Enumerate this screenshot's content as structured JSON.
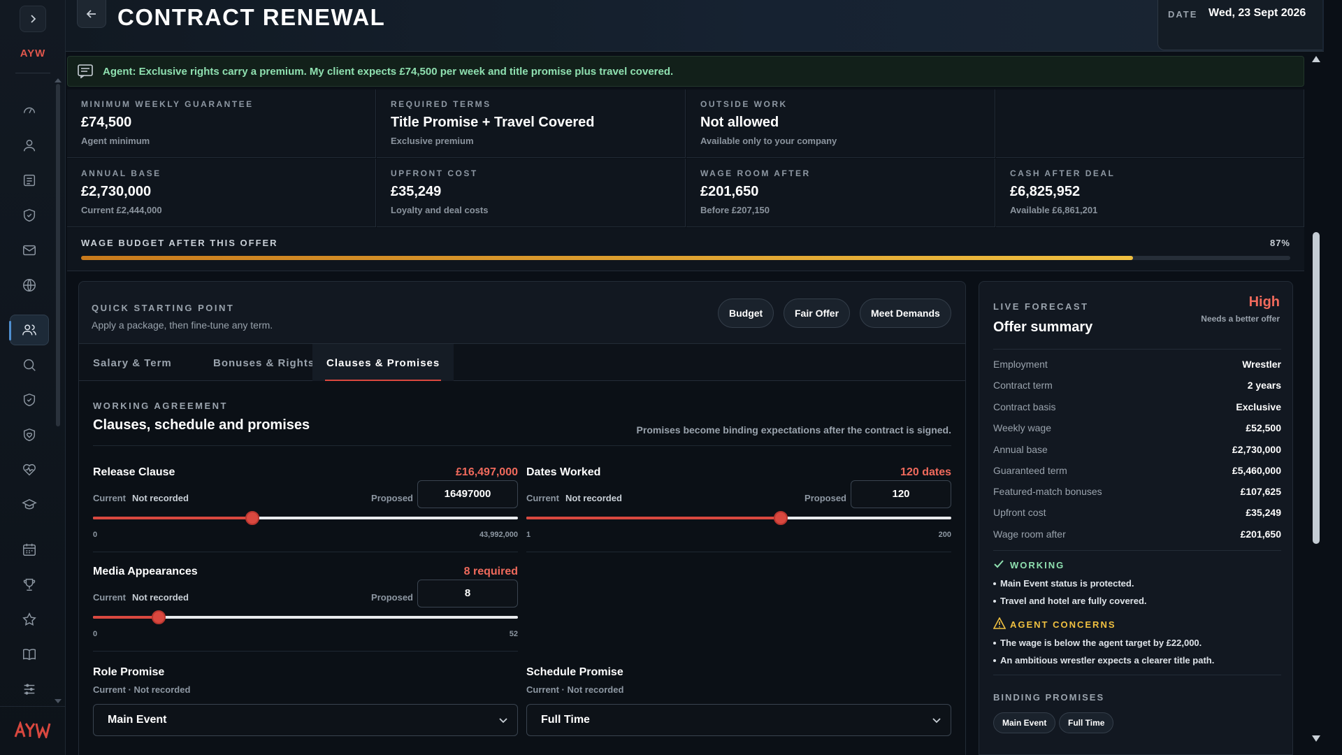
{
  "header": {
    "title": "CONTRACT RENEWAL",
    "date_label": "DATE",
    "date_value": "Wed, 23 Sept 2026"
  },
  "sidebar": {
    "brand": "AYW",
    "items": [
      {
        "icon": "speedometer-icon"
      },
      {
        "icon": "user-icon"
      },
      {
        "icon": "document-icon"
      },
      {
        "icon": "shield-icon"
      },
      {
        "icon": "mail-icon"
      },
      {
        "icon": "globe-icon"
      },
      {
        "icon": "users-icon",
        "active": true
      },
      {
        "icon": "search-icon"
      },
      {
        "icon": "shield-check-icon"
      },
      {
        "icon": "heart-shield-icon"
      },
      {
        "icon": "heart-pulse-icon"
      },
      {
        "icon": "graduation-cap-icon"
      },
      {
        "icon": "calendar-icon"
      },
      {
        "icon": "trophy-icon"
      },
      {
        "icon": "star-icon"
      },
      {
        "icon": "book-icon"
      },
      {
        "icon": "sliders-icon"
      }
    ],
    "logo": "AYW"
  },
  "agent_message": "Agent: Exclusive rights carry a premium. My client expects £74,500 per week and title promise plus travel covered.",
  "stats": {
    "min_weekly": {
      "label": "MINIMUM WEEKLY GUARANTEE",
      "value": "£74,500",
      "sub": "Agent minimum"
    },
    "required_terms": {
      "label": "REQUIRED TERMS",
      "value": "Title Promise + Travel Covered",
      "sub": "Exclusive premium"
    },
    "outside_work": {
      "label": "OUTSIDE WORK",
      "value": "Not allowed",
      "sub": "Available only to your company"
    },
    "annual_base": {
      "label": "ANNUAL BASE",
      "value": "£2,730,000",
      "sub": "Current £2,444,000"
    },
    "upfront_cost": {
      "label": "UPFRONT COST",
      "value": "£35,249",
      "sub": "Loyalty and deal costs"
    },
    "wage_room": {
      "label": "WAGE ROOM AFTER",
      "value": "£201,650",
      "sub": "Before £207,150"
    },
    "cash_after": {
      "label": "CASH AFTER DEAL",
      "value": "£6,825,952",
      "sub": "Available £6,861,201"
    }
  },
  "wage_budget": {
    "label": "WAGE BUDGET AFTER THIS OFFER",
    "percent_text": "87%",
    "fraction": 0.87
  },
  "quick_start": {
    "label": "QUICK STARTING POINT",
    "sub": "Apply a package, then fine-tune any term.",
    "buttons": [
      "Budget",
      "Fair Offer",
      "Meet Demands"
    ]
  },
  "tabs": [
    "Salary & Term",
    "Bonuses & Rights",
    "Clauses & Promises"
  ],
  "active_tab": 2,
  "working_agreement": {
    "label": "WORKING AGREEMENT",
    "title": "Clauses, schedule and promises",
    "note": "Promises become binding expectations after the contract is signed."
  },
  "fields": {
    "release_clause": {
      "title": "Release Clause",
      "target": "£16,497,000",
      "current_label": "Current",
      "current_value": "Not recorded",
      "proposed_label": "Proposed",
      "proposed_value": "16497000",
      "min": "0",
      "max": "43,992,000",
      "fraction": 0.375
    },
    "dates_worked": {
      "title": "Dates Worked",
      "target": "120 dates",
      "current_label": "Current",
      "current_value": "Not recorded",
      "proposed_label": "Proposed",
      "proposed_value": "120",
      "min": "1",
      "max": "200",
      "fraction": 0.598
    },
    "media_appearances": {
      "title": "Media Appearances",
      "target": "8 required",
      "current_label": "Current",
      "current_value": "Not recorded",
      "proposed_label": "Proposed",
      "proposed_value": "8",
      "min": "0",
      "max": "52",
      "fraction": 0.154
    }
  },
  "promises": {
    "role": {
      "title": "Role Promise",
      "current": "Current · Not recorded",
      "value": "Main Event"
    },
    "schedule": {
      "title": "Schedule Promise",
      "current": "Current · Not recorded",
      "value": "Full Time"
    }
  },
  "forecast": {
    "label": "LIVE FORECAST",
    "title": "Offer summary",
    "status": "High",
    "status_sub": "Needs a better offer",
    "rows": [
      {
        "k": "Employment",
        "v": "Wrestler"
      },
      {
        "k": "Contract term",
        "v": "2 years"
      },
      {
        "k": "Contract basis",
        "v": "Exclusive"
      },
      {
        "k": "Weekly wage",
        "v": "£52,500"
      },
      {
        "k": "Annual base",
        "v": "£2,730,000"
      },
      {
        "k": "Guaranteed term",
        "v": "£5,460,000"
      },
      {
        "k": "Featured-match bonuses",
        "v": "£107,625"
      },
      {
        "k": "Upfront cost",
        "v": "£35,249"
      },
      {
        "k": "Wage room after",
        "v": "£201,650"
      }
    ],
    "working_label": "WORKING",
    "working": [
      "Main Event status is protected.",
      "Travel and hotel are fully covered."
    ],
    "concerns_label": "AGENT CONCERNS",
    "concerns": [
      "The wage is below the agent target by £22,000.",
      "An ambitious wrestler expects a clearer title path."
    ],
    "binding_label": "BINDING PROMISES",
    "binding": [
      "Main Event",
      "Full Time"
    ]
  },
  "colors": {
    "accent_red": "#d9483f",
    "success_green": "#8fe0b0",
    "warning_yellow": "#f0c040",
    "budget_bar": "#e0a030"
  }
}
